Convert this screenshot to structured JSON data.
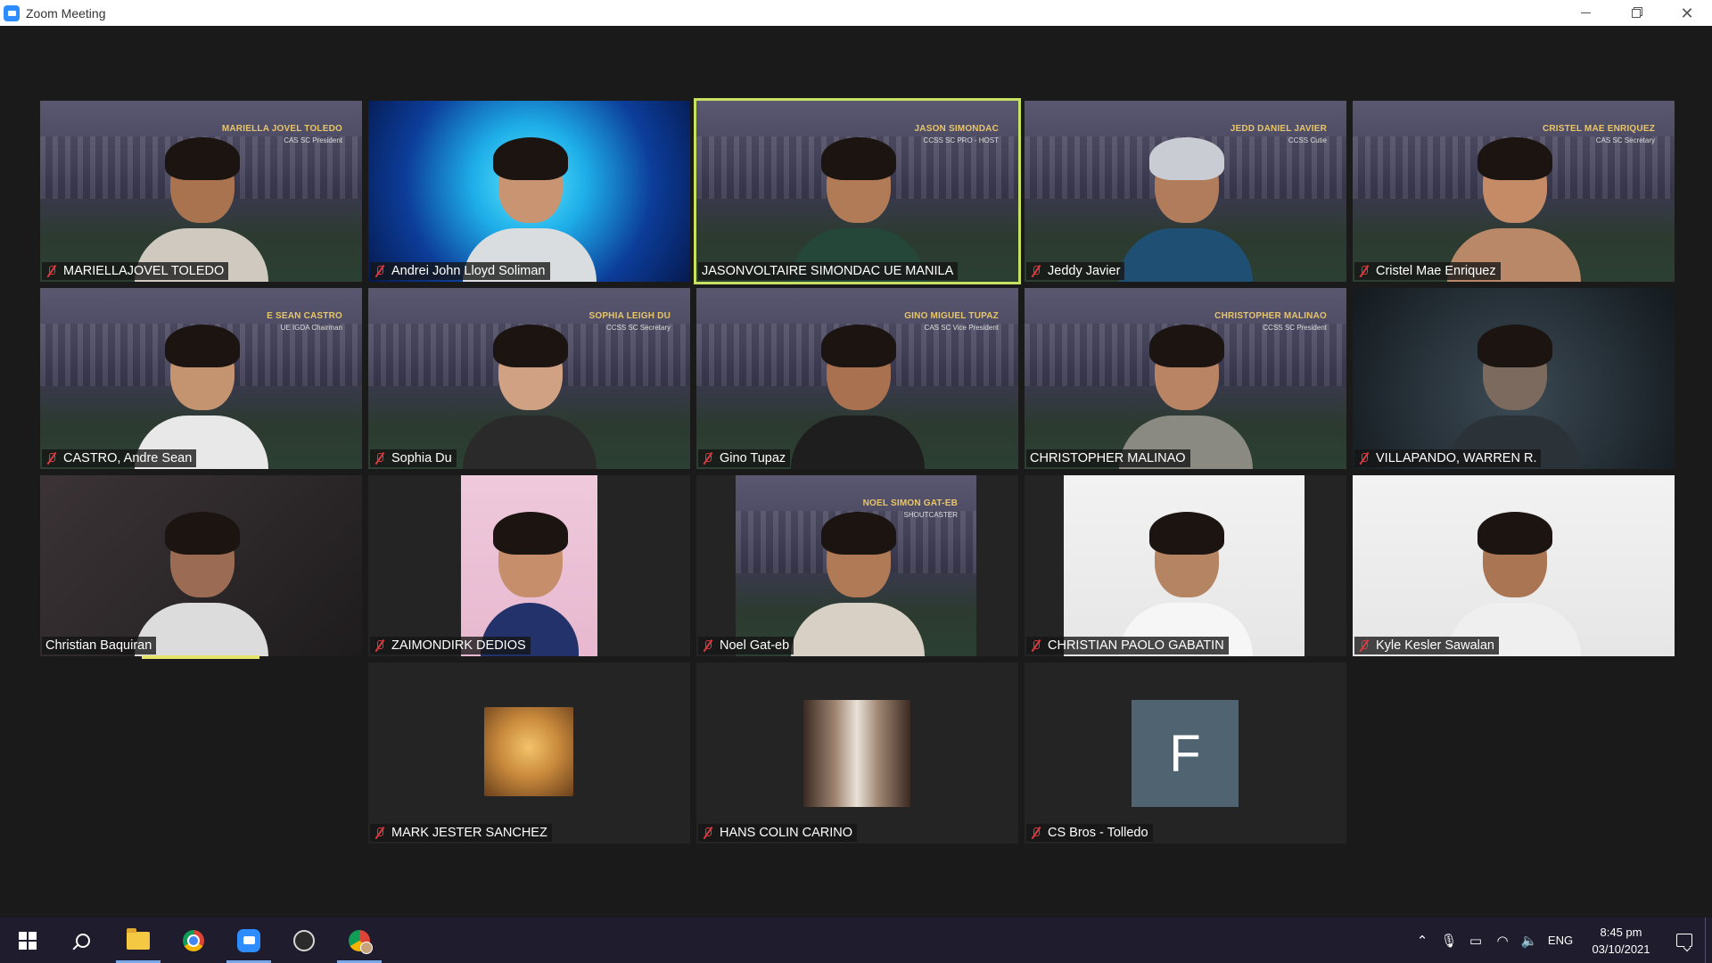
{
  "window": {
    "title": "Zoom Meeting"
  },
  "meeting": {
    "active_speaker": "JASONVOLTAIRE SIMONDAC UE MANILA",
    "participants": [
      {
        "name": "MARIELLAJOVEL TOLEDO",
        "muted": true,
        "banner_name": "MARIELLA JOVEL TOLEDO",
        "banner_title": "CAS SC President"
      },
      {
        "name": "Andrei John Lloyd Soliman",
        "muted": true
      },
      {
        "name": "JASONVOLTAIRE SIMONDAC UE MANILA",
        "muted": false,
        "banner_name": "JASON SIMONDAC",
        "banner_title": "CCSS SC PRO - HOST"
      },
      {
        "name": "Jeddy Javier",
        "muted": true,
        "banner_name": "JEDD DANIEL JAVIER",
        "banner_title": "CCSS Cutie"
      },
      {
        "name": "Cristel Mae Enriquez",
        "muted": true,
        "banner_name": "CRISTEL MAE ENRIQUEZ",
        "banner_title": "CAS SC Secretary"
      },
      {
        "name": "CASTRO, Andre Sean",
        "muted": true,
        "banner_name": "E SEAN CASTRO",
        "banner_title": "UE IGDA Chairman"
      },
      {
        "name": "Sophia Du",
        "muted": true,
        "banner_name": "SOPHIA LEIGH DU",
        "banner_title": "CCSS SC Secretary"
      },
      {
        "name": "Gino Tupaz",
        "muted": true,
        "banner_name": "GINO MIGUEL TUPAZ",
        "banner_title": "CAS SC Vice President"
      },
      {
        "name": "CHRISTOPHER MALINAO",
        "muted": false,
        "banner_name": "CHRISTOPHER MALINAO",
        "banner_title": "CCSS SC President"
      },
      {
        "name": "VILLAPANDO, WARREN R.",
        "muted": true
      },
      {
        "name": "Christian Baquiran",
        "muted": false
      },
      {
        "name": "ZAIMONDIRK DEDIOS",
        "muted": true
      },
      {
        "name": "Noel Gat-eb",
        "muted": true,
        "banner_name": "NOEL SIMON GAT-EB",
        "banner_title": "SHOUTCASTER"
      },
      {
        "name": "CHRISTIAN PAOLO GABATIN",
        "muted": true
      },
      {
        "name": "Kyle Kesler Sawalan",
        "muted": true
      },
      {
        "name": "MARK JESTER SANCHEZ",
        "muted": true
      },
      {
        "name": "HANS COLIN CARINO",
        "muted": true
      },
      {
        "name": "CS Bros - Tolledo",
        "muted": true,
        "avatar_letter": "F"
      }
    ]
  },
  "taskbar": {
    "pinned": [
      "windows-start",
      "search",
      "file-explorer",
      "chrome",
      "zoom",
      "obs-studio",
      "chrome-profile"
    ],
    "tray": {
      "language": "ENG",
      "time": "8:45 pm",
      "date": "03/10/2021"
    }
  },
  "colors": {
    "active_speaker_border": "#c7e263",
    "muted_icon": "#e0393e",
    "banner_text": "#e7c56b",
    "taskbar": "#1f1c2e"
  }
}
